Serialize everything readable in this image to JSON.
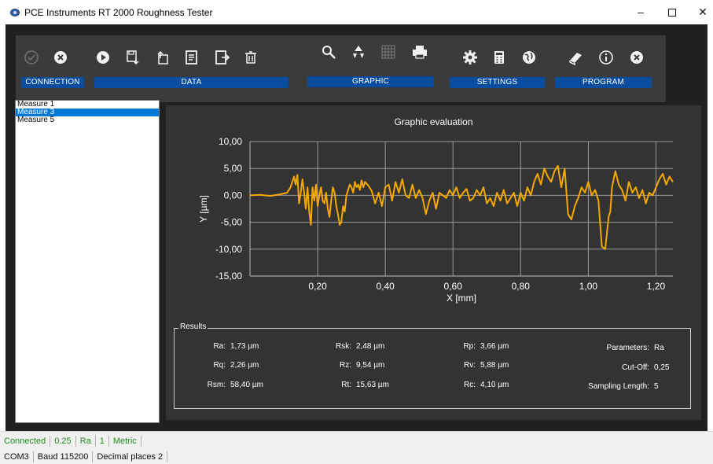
{
  "window": {
    "title": "PCE Instruments RT 2000 Roughness Tester",
    "minimize_glyph": "–",
    "close_glyph": "✕"
  },
  "toolbar": {
    "groups": [
      {
        "label": "CONNECTION"
      },
      {
        "label": "DATA"
      },
      {
        "label": "GRAPHIC"
      },
      {
        "label": "SETTINGS"
      },
      {
        "label": "PROGRAM"
      }
    ],
    "buttons": [
      {
        "name": "connect-check-icon",
        "enabled": false
      },
      {
        "name": "disconnect-x-icon",
        "enabled": true
      },
      {
        "name": "play-measure-icon",
        "enabled": true
      },
      {
        "name": "save-data-icon",
        "enabled": true
      },
      {
        "name": "open-data-icon",
        "enabled": true
      },
      {
        "name": "export-data-icon",
        "enabled": true
      },
      {
        "name": "export-report-icon",
        "enabled": true
      },
      {
        "name": "delete-trash-icon",
        "enabled": true
      },
      {
        "name": "zoom-search-icon",
        "enabled": true
      },
      {
        "name": "reset-recycle-icon",
        "enabled": true
      },
      {
        "name": "grid-icon",
        "enabled": false
      },
      {
        "name": "print-icon",
        "enabled": true
      },
      {
        "name": "settings-gear-icon",
        "enabled": true
      },
      {
        "name": "calculator-icon",
        "enabled": true
      },
      {
        "name": "language-globe-icon",
        "enabled": true
      },
      {
        "name": "manual-book-icon",
        "enabled": true
      },
      {
        "name": "info-icon",
        "enabled": true
      },
      {
        "name": "exit-x-icon",
        "enabled": true
      }
    ]
  },
  "measures": {
    "items": [
      "Measure 1",
      "Measure 3",
      "Measure 5"
    ],
    "selected_index": 1
  },
  "graph": {
    "title": "Graphic evaluation"
  },
  "chart_data": {
    "type": "line",
    "title": "Graphic evaluation",
    "xlabel": "X [mm]",
    "ylabel": "Y [µm]",
    "xlim": [
      0,
      1.25
    ],
    "ylim": [
      -15,
      10
    ],
    "x_ticks": [
      "0,20",
      "0,40",
      "0,60",
      "0,80",
      "1,00",
      "1,20"
    ],
    "y_ticks": [
      "10,00",
      "5,00",
      "0,00",
      "-5,00",
      "-10,00",
      "-15,00"
    ],
    "grid": true,
    "line_color": "#f5a800",
    "series": [
      {
        "x": [
          0.0,
          0.03,
          0.06,
          0.09,
          0.11,
          0.12,
          0.13,
          0.135,
          0.14,
          0.145,
          0.15,
          0.155,
          0.16,
          0.165,
          0.17,
          0.175,
          0.18,
          0.185,
          0.19,
          0.195,
          0.2,
          0.205,
          0.21,
          0.215,
          0.22,
          0.225,
          0.23,
          0.235,
          0.24,
          0.245,
          0.25,
          0.255,
          0.26,
          0.265,
          0.27,
          0.275,
          0.28,
          0.285,
          0.29,
          0.295,
          0.3,
          0.305,
          0.31,
          0.315,
          0.32,
          0.325,
          0.33,
          0.335,
          0.34,
          0.35,
          0.36,
          0.37,
          0.38,
          0.39,
          0.4,
          0.41,
          0.42,
          0.43,
          0.44,
          0.45,
          0.46,
          0.47,
          0.48,
          0.49,
          0.5,
          0.51,
          0.52,
          0.53,
          0.54,
          0.55,
          0.56,
          0.57,
          0.58,
          0.59,
          0.6,
          0.61,
          0.62,
          0.63,
          0.64,
          0.65,
          0.66,
          0.67,
          0.68,
          0.69,
          0.7,
          0.71,
          0.72,
          0.73,
          0.74,
          0.75,
          0.76,
          0.77,
          0.78,
          0.79,
          0.8,
          0.81,
          0.82,
          0.83,
          0.84,
          0.85,
          0.86,
          0.87,
          0.88,
          0.89,
          0.9,
          0.91,
          0.92,
          0.93,
          0.94,
          0.95,
          0.96,
          0.97,
          0.98,
          0.99,
          1.0,
          1.01,
          1.02,
          1.03,
          1.04,
          1.05,
          1.055,
          1.06,
          1.065,
          1.07,
          1.08,
          1.09,
          1.1,
          1.11,
          1.12,
          1.13,
          1.14,
          1.15,
          1.16,
          1.17,
          1.18,
          1.19,
          1.2,
          1.21,
          1.22,
          1.23,
          1.24,
          1.25
        ],
        "y": [
          0.0,
          0.1,
          -0.1,
          0.2,
          0.5,
          1.5,
          3.5,
          2.0,
          3.8,
          -1.5,
          0.5,
          3.0,
          0.5,
          -2.5,
          1.5,
          -3.0,
          -5.5,
          1.5,
          -1.0,
          2.0,
          -2.0,
          0.0,
          1.5,
          -1.0,
          -1.5,
          0.5,
          -2.5,
          -4.0,
          -1.0,
          1.5,
          0.5,
          -2.0,
          -3.5,
          -5.5,
          -5.0,
          -2.0,
          -3.0,
          0.0,
          1.0,
          2.0,
          1.5,
          0.5,
          2.5,
          1.5,
          2.0,
          1.0,
          2.8,
          1.5,
          2.5,
          1.8,
          0.8,
          -1.5,
          0.5,
          -2.0,
          1.5,
          2.0,
          -1.0,
          2.5,
          0.5,
          3.0,
          0.0,
          -0.5,
          2.0,
          -0.5,
          1.0,
          -0.5,
          -3.5,
          -1.0,
          0.5,
          -2.5,
          0.5,
          0.0,
          -0.5,
          1.0,
          0.0,
          1.5,
          -0.5,
          0.5,
          1.2,
          -1.0,
          -0.5,
          1.0,
          0.0,
          1.5,
          -1.5,
          -0.5,
          -2.0,
          0.5,
          -1.0,
          1.0,
          -1.5,
          -0.5,
          0.5,
          -2.0,
          0.5,
          -1.0,
          1.5,
          0.0,
          2.5,
          4.0,
          2.0,
          5.0,
          3.5,
          2.5,
          4.5,
          5.5,
          1.5,
          5.0,
          -3.5,
          -4.5,
          -2.0,
          -0.5,
          1.5,
          0.5,
          2.5,
          0.0,
          1.0,
          -1.0,
          -9.5,
          -10.0,
          -7.0,
          -4.0,
          -3.0,
          1.5,
          4.5,
          2.0,
          1.0,
          -1.0,
          2.5,
          0.5,
          1.5,
          -0.5,
          1.0,
          -1.5,
          0.5,
          0.0,
          1.5,
          3.0,
          4.0,
          2.0,
          3.5,
          2.5
        ]
      }
    ]
  },
  "results": {
    "legend": "Results",
    "columns": [
      [
        {
          "label": "Ra:",
          "value": "1,73 µm"
        },
        {
          "label": "Rq:",
          "value": "2,26 µm"
        },
        {
          "label": "Rsm:",
          "value": "58,40 µm"
        }
      ],
      [
        {
          "label": "Rsk:",
          "value": "2,48 µm"
        },
        {
          "label": "Rz:",
          "value": "9,54 µm"
        },
        {
          "label": "Rt:",
          "value": "15,63 µm"
        }
      ],
      [
        {
          "label": "Rp:",
          "value": "3,66 µm"
        },
        {
          "label": "Rv:",
          "value": "5,88 µm"
        },
        {
          "label": "Rc:",
          "value": "4,10 µm"
        }
      ],
      [
        {
          "label": "Parameters:",
          "value": "Ra"
        },
        {
          "label": "Cut-Off:",
          "value": "0,25"
        },
        {
          "label": "Sampling Length:",
          "value": "5"
        }
      ]
    ]
  },
  "statusbar": {
    "row1": [
      "Connected",
      "0.25",
      "Ra",
      "1",
      "Metric"
    ],
    "row2": [
      "COM3",
      "Baud 115200",
      "Decimal places 2"
    ]
  },
  "colors": {
    "accent_blue": "#0a4d9e",
    "selection": "#0078d7",
    "status_green": "#1b8a1b",
    "trace": "#f5a800"
  }
}
